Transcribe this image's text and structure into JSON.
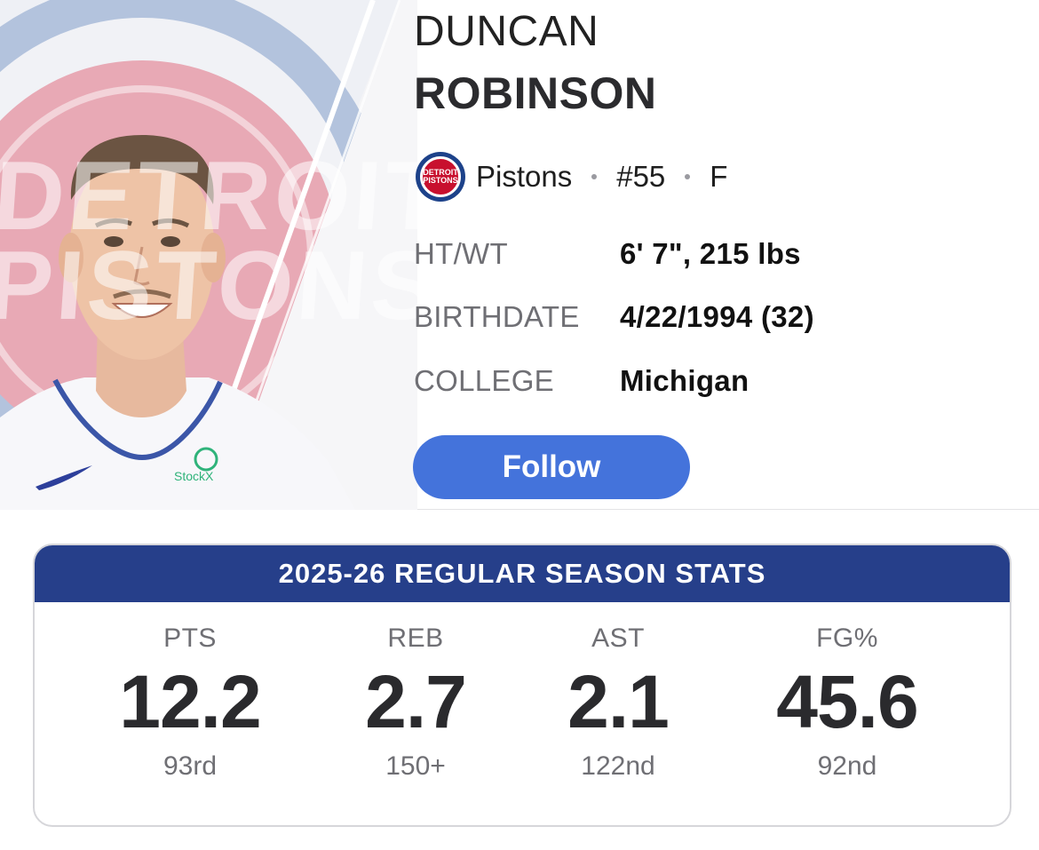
{
  "player": {
    "first_name": "DUNCAN",
    "last_name": "ROBINSON",
    "team": "Pistons",
    "team_logo_text": "DETROIT PISTONS",
    "number": "#55",
    "position": "F",
    "jersey_brand": "StockX",
    "background_text": "DETROIT PISTONS"
  },
  "info": [
    {
      "label": "HT/WT",
      "value": "6' 7\", 215 lbs"
    },
    {
      "label": "BIRTHDATE",
      "value": "4/22/1994 (32)"
    },
    {
      "label": "COLLEGE",
      "value": "Michigan"
    }
  ],
  "follow_label": "Follow",
  "stats": {
    "title": "2025-26 REGULAR SEASON STATS",
    "items": [
      {
        "label": "PTS",
        "value": "12.2",
        "rank": "93rd"
      },
      {
        "label": "REB",
        "value": "2.7",
        "rank": "150+"
      },
      {
        "label": "AST",
        "value": "2.1",
        "rank": "122nd"
      },
      {
        "label": "FG%",
        "value": "45.6",
        "rank": "92nd"
      }
    ]
  },
  "colors": {
    "accent_button": "#4473db",
    "stats_header": "#263f8a",
    "team_red": "#c8102e",
    "team_blue": "#1d428a"
  }
}
